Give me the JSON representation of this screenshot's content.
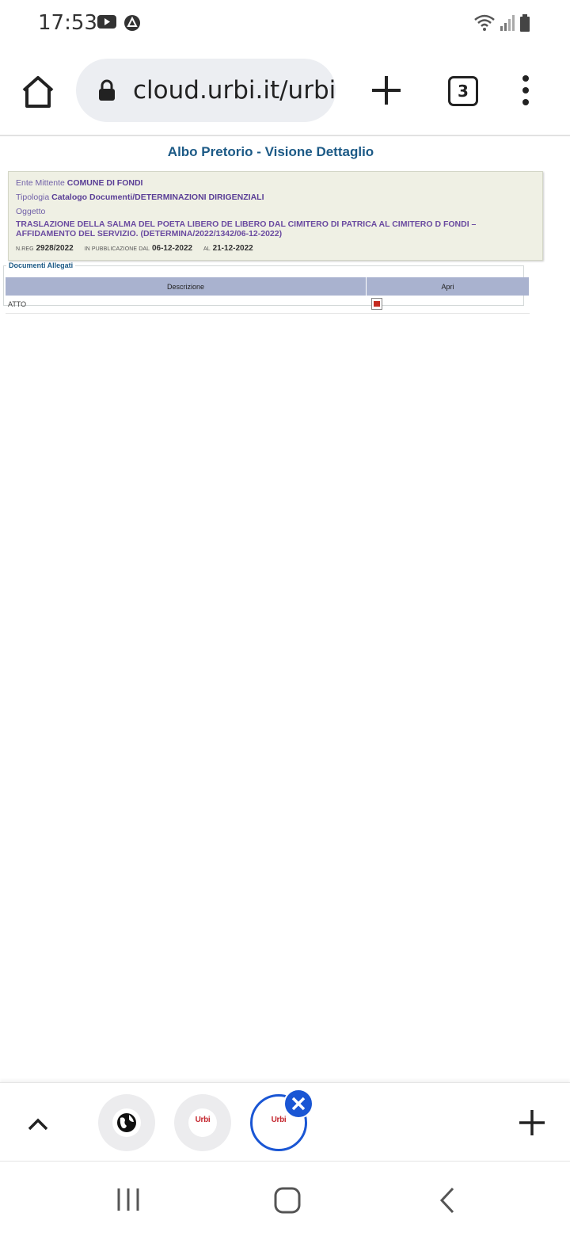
{
  "status_bar": {
    "time": "17:53",
    "icons": [
      "youtube-icon",
      "vpn-icon",
      "wifi-icon",
      "signal-icon",
      "battery-icon"
    ]
  },
  "browser": {
    "url": "cloud.urbi.it/urbi/",
    "tab_count": "3",
    "icons": [
      "home-icon",
      "lock-icon",
      "plus-icon",
      "more-vert-icon"
    ]
  },
  "page": {
    "title": "Albo Pretorio - Visione Dettaglio",
    "ente_label": "Ente Mittente",
    "ente_value": "COMUNE DI FONDI",
    "tipologia_label": "Tipologia",
    "tipologia_value": "Catalogo Documenti/DETERMINAZIONI DIRIGENZIALI",
    "oggetto_label": "Oggetto",
    "oggetto_value": "TRASLAZIONE DELLA SALMA DEL POETA LIBERO DE LIBERO DAL CIMITERO DI PATRICA AL CIMITERO D FONDI – AFFIDAMENTO DEL SERVIZIO. (DETERMINA/2022/1342/06-12-2022)",
    "nreg_label": "N.REG",
    "nreg_value": "2928/2022",
    "pubblicazione_label": "IN PUBBLICAZIONE DAL",
    "pubblicazione_value": "06-12-2022",
    "al_label": "AL",
    "al_value": "21-12-2022",
    "attachments": {
      "legend": "Documenti Allegati",
      "headers": [
        "Descrizione",
        "Apri"
      ],
      "rows": [
        {
          "descrizione": "ATTO",
          "apri_icon": "pdf-icon"
        }
      ]
    }
  },
  "tab_strip": {
    "tabs": [
      {
        "icon": "globe-icon",
        "label": ""
      },
      {
        "icon": "urbi-logo",
        "label": "Urbi"
      },
      {
        "icon": "urbi-logo",
        "label": "Urbi",
        "active": true
      }
    ],
    "icons": [
      "chevron-up-icon",
      "close-icon",
      "plus-icon"
    ]
  },
  "nav_bar": {
    "icons": [
      "recents-icon",
      "home-nav-icon",
      "back-icon"
    ]
  },
  "colors": {
    "title": "#1c5a86",
    "detail_bg": "#eff0e4",
    "table_header": "#a9b2cf",
    "active_tab": "#1a56d4",
    "urbi_red": "#c4262e"
  }
}
